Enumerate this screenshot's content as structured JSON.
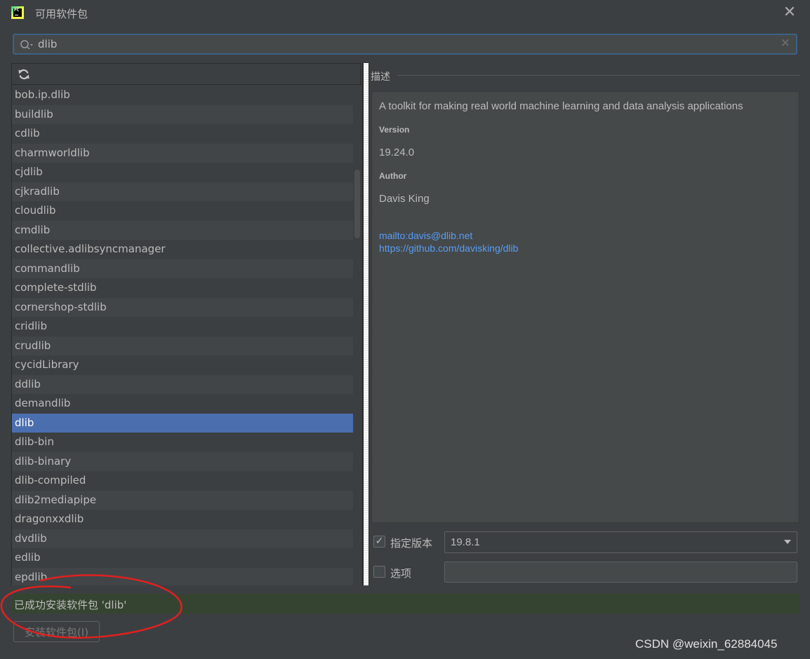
{
  "window": {
    "title": "可用软件包",
    "logo_text": "PC"
  },
  "search": {
    "value": "dlib",
    "icon": "search-icon"
  },
  "packages": [
    "bob.ip.dlib",
    "buildlib",
    "cdlib",
    "charmworldlib",
    "cjdlib",
    "cjkradlib",
    "cloudlib",
    "cmdlib",
    "collective.adlibsyncmanager",
    "commandlib",
    "complete-stdlib",
    "cornershop-stdlib",
    "cridlib",
    "crudlib",
    "cycidLibrary",
    "ddlib",
    "demandlib",
    "dlib",
    "dlib-bin",
    "dlib-binary",
    "dlib-compiled",
    "dlib2mediapipe",
    "dragonxxdlib",
    "dvdlib",
    "edlib",
    "epdlib"
  ],
  "selected_package": "dlib",
  "description": {
    "header": "描述",
    "summary": "A toolkit for making real world machine learning and data analysis applications",
    "version_label": "Version",
    "version_value": "19.24.0",
    "author_label": "Author",
    "author_value": "Davis King",
    "link_email": "mailto:davis@dlib.net",
    "link_repo": "https://github.com/davisking/dlib"
  },
  "options": {
    "specify_version_label": "指定版本",
    "specify_version_checked": true,
    "selected_version": "19.8.1",
    "options_label": "选项",
    "options_checked": false,
    "options_value": ""
  },
  "status": {
    "message": "已成功安装软件包 'dlib'"
  },
  "install_button_label": "安装软件包(I)",
  "watermark": "CSDN @weixin_62884045",
  "colors": {
    "selected_row": "#4b6eaf",
    "link": "#589df6",
    "status_success_bg": "#354430",
    "annotation_red": "#e02020"
  }
}
